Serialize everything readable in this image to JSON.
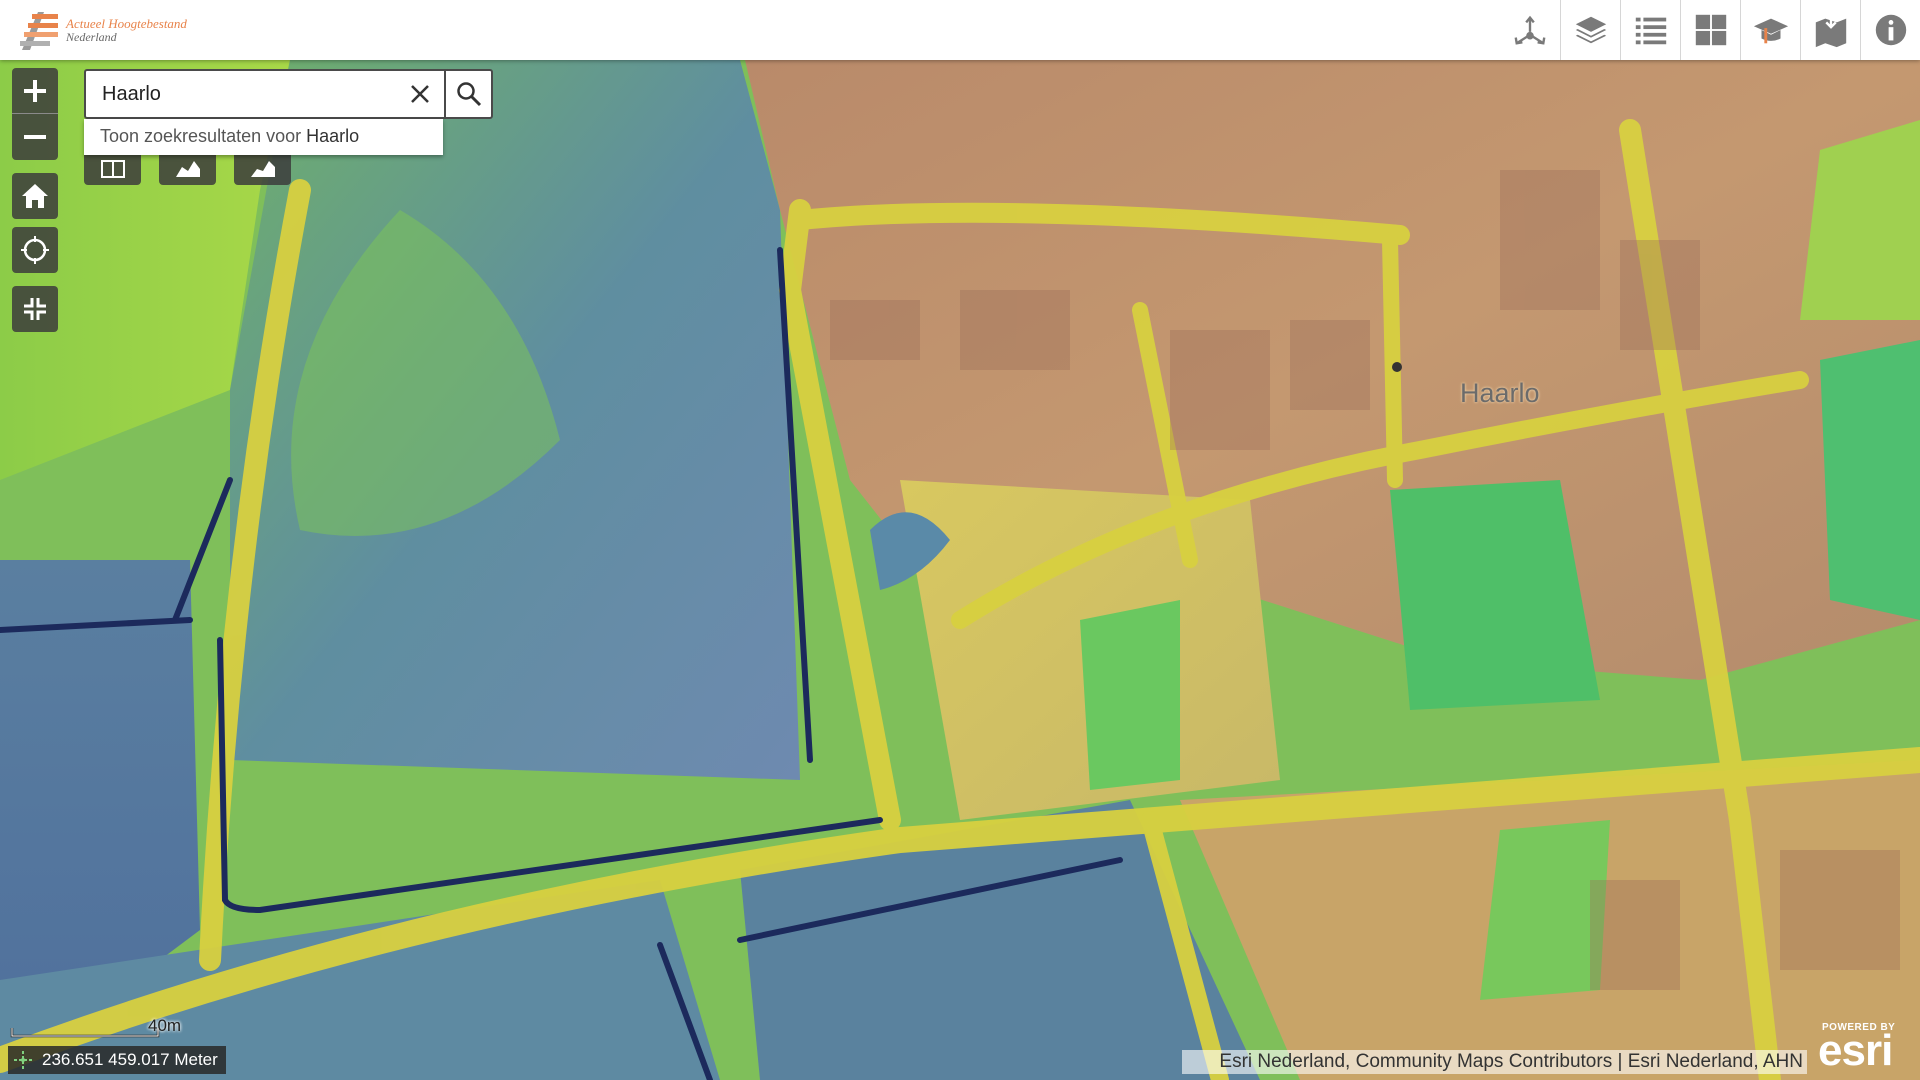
{
  "header": {
    "logo_line1": "Actueel Hoogtebestand",
    "logo_line2": "Nederland",
    "tools": [
      {
        "icon": "share-network-icon"
      },
      {
        "icon": "layers-icon"
      },
      {
        "icon": "legend-list-icon"
      },
      {
        "icon": "basemap-gallery-icon"
      },
      {
        "icon": "education-cap-icon"
      },
      {
        "icon": "download-tile-icon"
      },
      {
        "icon": "info-icon"
      }
    ]
  },
  "search": {
    "value": "Haarlo",
    "suggestion_prefix": "Toon zoekresultaten voor ",
    "suggestion_term": "Haarlo"
  },
  "map": {
    "place_label": "Haarlo",
    "scale_label": "40m",
    "coordinates": "236.651 459.017 Meter",
    "attribution": "Esri Nederland, Community Maps Contributors | Esri Nederland, AHN",
    "powered_by": "POWERED BY",
    "esri_logo": "esri"
  },
  "colors": {
    "header_bg": "#ffffff",
    "control_bg": "#3c3c3c",
    "logo_orange": "#e8834a",
    "terrain_low": "#5f7fa8",
    "terrain_mid": "#8fd14f",
    "terrain_high": "#b9866c"
  }
}
